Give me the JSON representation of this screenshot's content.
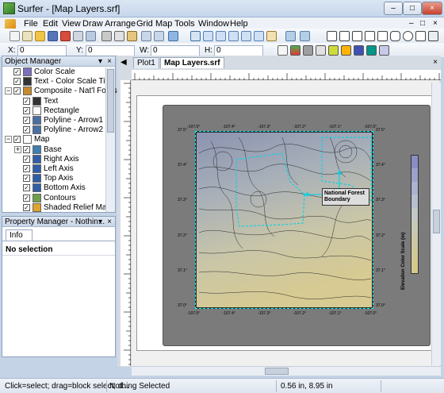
{
  "window": {
    "title": "Surfer - [Map Layers.srf]",
    "controls": [
      "–",
      "□",
      "×"
    ]
  },
  "menubar": {
    "items": [
      "File",
      "Edit",
      "View",
      "Draw",
      "Arrange",
      "Grid",
      "Map",
      "Tools",
      "Window",
      "Help"
    ],
    "doc_controls": [
      "–",
      "□",
      "×"
    ]
  },
  "coords": {
    "x_label": "X:",
    "x_value": "0",
    "y_label": "Y:",
    "y_value": "0",
    "w_label": "W:",
    "w_value": "0",
    "h_label": "H:",
    "h_value": "0"
  },
  "object_manager": {
    "title": "Object Manager",
    "controls": [
      "▾",
      "×"
    ],
    "items": [
      {
        "label": "Color Scale",
        "checked": true,
        "level": 0,
        "icon": "color-scale-icon"
      },
      {
        "label": "Text - Color Scale Title",
        "checked": true,
        "level": 0,
        "icon": "text-icon"
      },
      {
        "label": "Composite - Nat'l Forest",
        "checked": true,
        "level": 0,
        "icon": "composite-icon",
        "expander": "−"
      },
      {
        "label": "Text",
        "checked": true,
        "level": 1,
        "icon": "text-icon"
      },
      {
        "label": "Rectangle",
        "checked": true,
        "level": 1,
        "icon": "rectangle-icon"
      },
      {
        "label": "Polyline - Arrow1",
        "checked": true,
        "level": 1,
        "icon": "polyline-icon"
      },
      {
        "label": "Polyline - Arrow2",
        "checked": true,
        "level": 1,
        "icon": "polyline-icon"
      },
      {
        "label": "Map",
        "checked": true,
        "level": 0,
        "icon": "map-frame-icon",
        "expander": "−"
      },
      {
        "label": "Base",
        "checked": true,
        "level": 1,
        "icon": "base-map-icon",
        "expander": "+"
      },
      {
        "label": "Right Axis",
        "checked": true,
        "level": 1,
        "icon": "axis-icon"
      },
      {
        "label": "Left Axis",
        "checked": true,
        "level": 1,
        "icon": "axis-icon"
      },
      {
        "label": "Top Axis",
        "checked": true,
        "level": 1,
        "icon": "axis-icon"
      },
      {
        "label": "Bottom Axis",
        "checked": true,
        "level": 1,
        "icon": "axis-icon"
      },
      {
        "label": "Contours",
        "checked": true,
        "level": 1,
        "icon": "contour-icon"
      },
      {
        "label": "Shaded Relief Map",
        "checked": true,
        "level": 1,
        "icon": "shaded-relief-icon"
      }
    ]
  },
  "property_manager": {
    "title": "Property Manager - Nothin...",
    "controls": [
      "▾",
      "×"
    ],
    "tab": "Info",
    "content": "No selection"
  },
  "tabs": {
    "nav": "◀",
    "items": [
      "Plot1",
      "Map Layers.srf"
    ],
    "active": 1
  },
  "map": {
    "top_ticks": [
      "-107.5°",
      "-107.4°",
      "-107.3°",
      "-107.2°",
      "-107.1°",
      "-107.0°"
    ],
    "bottom_ticks": [
      "-107.5°",
      "-107.4°",
      "-107.3°",
      "-107.2°",
      "-107.1°",
      "-107.0°"
    ],
    "left_ticks": [
      "37.5°",
      "37.4°",
      "37.3°",
      "37.2°",
      "37.1°",
      "37.0°"
    ],
    "right_ticks": [
      "37.5°",
      "37.4°",
      "37.3°",
      "37.2°",
      "37.1°",
      "37.0°"
    ],
    "callout": "National Forest\nBoundary",
    "color_scale_title": "Elevation Color Scale (m)",
    "color_scale_colors": [
      "#8a8ec4",
      "#9ba3cc",
      "#aab3d0",
      "#b8c0d0",
      "#c3c9c8",
      "#c8cab8",
      "#cdc9a6",
      "#d1c898",
      "#d5c88c"
    ]
  },
  "status": {
    "hint": "Click=select; drag=block select; d...",
    "selection": "Nothing Selected",
    "position": "0.56 in, 8.95 in"
  }
}
